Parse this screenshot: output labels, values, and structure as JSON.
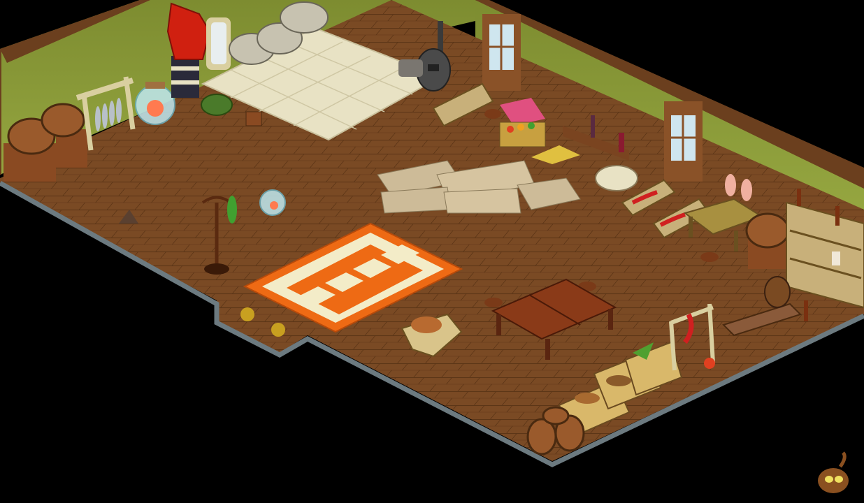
{
  "scene": {
    "name": "isometric-house-interior",
    "palette": {
      "background": "#000000",
      "wall": "#8a9a38",
      "wall_dark": "#6f7d2a",
      "floor": "#7a4a24",
      "floor_line": "#5a3416",
      "tile": "#e8e2c4",
      "beam": "#6b3f1e",
      "rug_orange": "#ee6a14",
      "rug_cream": "#f3ecc8",
      "stone_edge": "#6c7a80"
    }
  },
  "objects": [
    {
      "name": "red-dragon-statue",
      "icon": "dragon-totem"
    },
    {
      "name": "standing-mirror",
      "icon": "mirror"
    },
    {
      "name": "grain-sacks",
      "icon": "sacks"
    },
    {
      "name": "wood-stove",
      "icon": "stove"
    },
    {
      "name": "fish-drying-rack",
      "icon": "fish-rack"
    },
    {
      "name": "wooden-barrels",
      "icon": "barrel"
    },
    {
      "name": "glass-fishbowl",
      "icon": "fishbowl"
    },
    {
      "name": "green-cushion",
      "icon": "cushion"
    },
    {
      "name": "coat-rack",
      "icon": "coat-rack"
    },
    {
      "name": "orange-rug",
      "icon": "rug"
    },
    {
      "name": "parchment-sheets",
      "icon": "parchment"
    },
    {
      "name": "market-stall",
      "icon": "stall"
    },
    {
      "name": "bottle-shelf",
      "icon": "bottles"
    },
    {
      "name": "meat-crates",
      "icon": "meat"
    },
    {
      "name": "butcher-table",
      "icon": "table"
    },
    {
      "name": "wooden-dining-table",
      "icon": "table"
    },
    {
      "name": "bread-cart",
      "icon": "bread"
    },
    {
      "name": "supply-crates",
      "icon": "crate"
    },
    {
      "name": "meat-hanging-rack",
      "icon": "gallows"
    },
    {
      "name": "alchemy-bench",
      "icon": "alchemy"
    },
    {
      "name": "cupboard-shelves",
      "icon": "shelf"
    }
  ]
}
